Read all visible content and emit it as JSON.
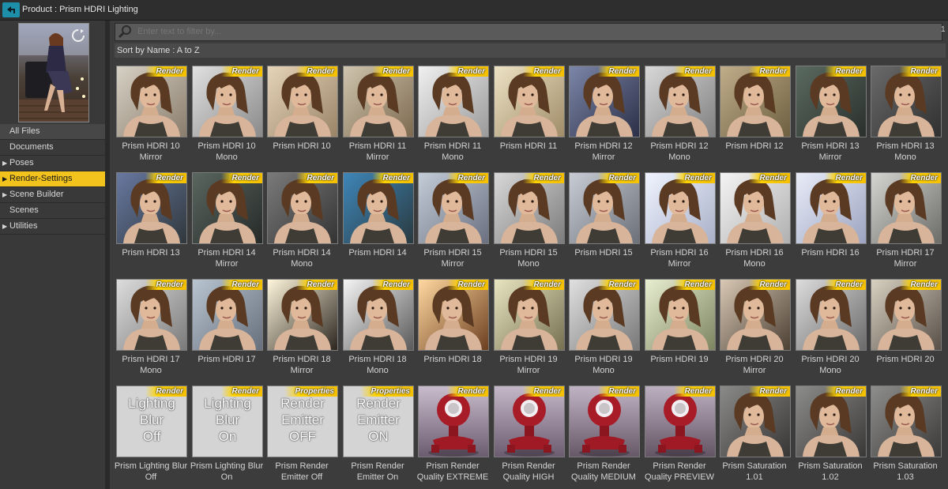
{
  "header": {
    "product_label": "Product :  Prism HDRI Lighting"
  },
  "sidebar": {
    "items": [
      {
        "label": "All Files",
        "arrow": false,
        "root": true,
        "selected": false
      },
      {
        "label": "Documents",
        "arrow": false,
        "root": false,
        "selected": false
      },
      {
        "label": "Poses",
        "arrow": true,
        "root": false,
        "selected": false
      },
      {
        "label": "Render-Settings",
        "arrow": true,
        "root": false,
        "selected": true
      },
      {
        "label": "Scene Builder",
        "arrow": true,
        "root": false,
        "selected": false
      },
      {
        "label": "Scenes",
        "arrow": false,
        "root": false,
        "selected": false
      },
      {
        "label": "Utilities",
        "arrow": true,
        "root": false,
        "selected": false
      }
    ]
  },
  "filter": {
    "placeholder": "Enter text to filter by...",
    "count": "1"
  },
  "sort": {
    "label": "Sort by Name : A to Z"
  },
  "tiles": [
    {
      "label": "Prism HDRI 10\nMirror",
      "badge": "Render",
      "kind": "portrait",
      "bg": [
        "#d6d0c4",
        "#8a7d6c"
      ]
    },
    {
      "label": "Prism HDRI 10\nMono",
      "badge": "Render",
      "kind": "portrait",
      "bg": [
        "#e0e0e0",
        "#8a8a8a"
      ]
    },
    {
      "label": "Prism HDRI 10",
      "badge": "Render",
      "kind": "portrait",
      "bg": [
        "#e6d4b8",
        "#9a8468"
      ]
    },
    {
      "label": "Prism HDRI 11\nMirror",
      "badge": "Render",
      "kind": "portrait",
      "bg": [
        "#cfc4ae",
        "#7d6a50"
      ]
    },
    {
      "label": "Prism HDRI 11\nMono",
      "badge": "Render",
      "kind": "portrait",
      "bg": [
        "#f0f0f0",
        "#9a9a9a"
      ]
    },
    {
      "label": "Prism HDRI 11",
      "badge": "Render",
      "kind": "portrait",
      "bg": [
        "#ece2c4",
        "#a08c68"
      ]
    },
    {
      "label": "Prism HDRI 12\nMirror",
      "badge": "Render",
      "kind": "portrait",
      "bg": [
        "#7c86a8",
        "#2c3048"
      ]
    },
    {
      "label": "Prism HDRI 12\nMono",
      "badge": "Render",
      "kind": "portrait",
      "bg": [
        "#d8d8d8",
        "#808080"
      ]
    },
    {
      "label": "Prism HDRI 12",
      "badge": "Render",
      "kind": "portrait",
      "bg": [
        "#c0ad8a",
        "#6d6040"
      ]
    },
    {
      "label": "Prism HDRI 13\nMirror",
      "badge": "Render",
      "kind": "portrait",
      "bg": [
        "#5a6a60",
        "#2a302c"
      ]
    },
    {
      "label": "Prism HDRI 13\nMono",
      "badge": "Render",
      "kind": "portrait",
      "bg": [
        "#6a6a6a",
        "#303030"
      ]
    },
    {
      "label": "Prism HDRI 13",
      "badge": "Render",
      "kind": "portrait",
      "bg": [
        "#6878a0",
        "#30383c"
      ]
    },
    {
      "label": "Prism HDRI 14\nMirror",
      "badge": "Render",
      "kind": "portrait",
      "bg": [
        "#5a6660",
        "#262a28"
      ]
    },
    {
      "label": "Prism HDRI 14\nMono",
      "badge": "Render",
      "kind": "portrait",
      "bg": [
        "#7a7a7a",
        "#343434"
      ]
    },
    {
      "label": "Prism HDRI 14",
      "badge": "Render",
      "kind": "portrait",
      "bg": [
        "#3e86b8",
        "#2a3a40"
      ]
    },
    {
      "label": "Prism HDRI 15\nMirror",
      "badge": "Render",
      "kind": "portrait",
      "bg": [
        "#c4ccd8",
        "#6a7080"
      ]
    },
    {
      "label": "Prism HDRI 15\nMono",
      "badge": "Render",
      "kind": "portrait",
      "bg": [
        "#d8d8d8",
        "#7c7c7c"
      ]
    },
    {
      "label": "Prism HDRI 15",
      "badge": "Render",
      "kind": "portrait",
      "bg": [
        "#c8ccd4",
        "#6c7078"
      ]
    },
    {
      "label": "Prism HDRI 16\nMirror",
      "badge": "Render",
      "kind": "portrait",
      "bg": [
        "#f0f4ff",
        "#a8b0c8"
      ]
    },
    {
      "label": "Prism HDRI 16\nMono",
      "badge": "Render",
      "kind": "portrait",
      "bg": [
        "#f4f4f4",
        "#b0b0b0"
      ]
    },
    {
      "label": "Prism HDRI 16",
      "badge": "Render",
      "kind": "portrait",
      "bg": [
        "#e8ecf8",
        "#9ca4c0"
      ]
    },
    {
      "label": "Prism HDRI 17\nMirror",
      "badge": "Render",
      "kind": "portrait",
      "bg": [
        "#d4d4d0",
        "#6c6c68"
      ]
    },
    {
      "label": "Prism HDRI 17\nMono",
      "badge": "Render",
      "kind": "portrait",
      "bg": [
        "#dcdcdc",
        "#7a7a7a"
      ]
    },
    {
      "label": "Prism HDRI 17",
      "badge": "Render",
      "kind": "portrait",
      "bg": [
        "#b8c4d0",
        "#66707c"
      ]
    },
    {
      "label": "Prism HDRI 18\nMirror",
      "badge": "Render",
      "kind": "portrait",
      "bg": [
        "#fff6dc",
        "#2c2620"
      ]
    },
    {
      "label": "Prism HDRI 18\nMono",
      "badge": "Render",
      "kind": "portrait",
      "bg": [
        "#f4f4f4",
        "#5a5a5a"
      ]
    },
    {
      "label": "Prism HDRI 18",
      "badge": "Render",
      "kind": "portrait",
      "bg": [
        "#ffd8a0",
        "#6c4020"
      ]
    },
    {
      "label": "Prism HDRI 19\nMirror",
      "badge": "Render",
      "kind": "portrait",
      "bg": [
        "#e8e4c0",
        "#767050"
      ]
    },
    {
      "label": "Prism HDRI 19\nMono",
      "badge": "Render",
      "kind": "portrait",
      "bg": [
        "#e0e0e0",
        "#787878"
      ]
    },
    {
      "label": "Prism HDRI 19",
      "badge": "Render",
      "kind": "portrait",
      "bg": [
        "#e8eed0",
        "#7c8460"
      ]
    },
    {
      "label": "Prism HDRI 20\nMirror",
      "badge": "Render",
      "kind": "portrait",
      "bg": [
        "#d8c8b4",
        "#4c4034"
      ]
    },
    {
      "label": "Prism HDRI 20\nMono",
      "badge": "Render",
      "kind": "portrait",
      "bg": [
        "#dcdcdc",
        "#6a6a6a"
      ]
    },
    {
      "label": "Prism HDRI 20",
      "badge": "Render",
      "kind": "portrait",
      "bg": [
        "#d8d0c0",
        "#585048"
      ]
    },
    {
      "label": "Prism Lighting Blur\nOff",
      "badge": "Render",
      "kind": "text",
      "text": "Lighting\nBlur\nOff"
    },
    {
      "label": "Prism Lighting Blur\nOn",
      "badge": "Render",
      "kind": "text",
      "text": "Lighting\nBlur\nOn"
    },
    {
      "label": "Prism Render\nEmitter Off",
      "badge": "Properties",
      "kind": "text",
      "text": "Render\nEmitter\nOFF"
    },
    {
      "label": "Prism Render\nEmitter On",
      "badge": "Properties",
      "kind": "text",
      "text": "Render\nEmitter\nON"
    },
    {
      "label": "Prism Render\nQuality EXTREME",
      "badge": "Render",
      "kind": "robot",
      "bg": [
        "#c8bccc",
        "#6c5c70"
      ]
    },
    {
      "label": "Prism Render\nQuality HIGH",
      "badge": "Render",
      "kind": "robot",
      "bg": [
        "#c4b8c8",
        "#6c5c70"
      ]
    },
    {
      "label": "Prism Render\nQuality MEDIUM",
      "badge": "Render",
      "kind": "robot",
      "bg": [
        "#c0b4c4",
        "#685868"
      ]
    },
    {
      "label": "Prism Render\nQuality PREVIEW",
      "badge": "Render",
      "kind": "robot",
      "bg": [
        "#bcb0c0",
        "#645464"
      ]
    },
    {
      "label": "Prism Saturation\n1.01",
      "badge": "Render",
      "kind": "portrait",
      "bg": [
        "#8a8a88",
        "#383634"
      ]
    },
    {
      "label": "Prism Saturation\n1.02",
      "badge": "Render",
      "kind": "portrait",
      "bg": [
        "#8c8c8a",
        "#3a3836"
      ]
    },
    {
      "label": "Prism Saturation\n1.03",
      "badge": "Render",
      "kind": "portrait",
      "bg": [
        "#8e8e8c",
        "#3c3a38"
      ]
    }
  ]
}
